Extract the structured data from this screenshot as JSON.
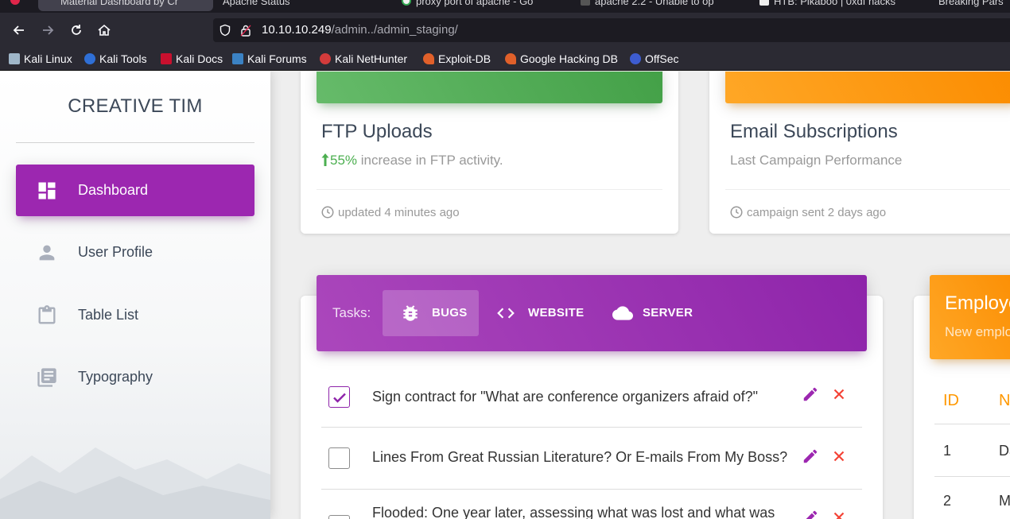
{
  "browser": {
    "tabs": [
      {
        "label": "Material Dashboard by Cr"
      },
      {
        "label": "Apache Status"
      },
      {
        "label": "proxy port of apache - Go"
      },
      {
        "label": "apache 2.2 - Unable to op"
      },
      {
        "label": "HTB: Pikaboo | 0xdf hacks"
      },
      {
        "label": "Breaking Pars"
      }
    ],
    "url_host": "10.10.10.249",
    "url_path": "/admin../admin_staging/",
    "bookmarks": [
      {
        "label": "Kali Linux",
        "color": "#9fb6c9"
      },
      {
        "label": "Kali Tools",
        "color": "#2f6fd6"
      },
      {
        "label": "Kali Docs",
        "color": "#c8102e"
      },
      {
        "label": "Kali Forums",
        "color": "#3b82c4"
      },
      {
        "label": "Kali NetHunter",
        "color": "#d23b3b"
      },
      {
        "label": "Exploit-DB",
        "color": "#e0602a"
      },
      {
        "label": "Google Hacking DB",
        "color": "#e0602a"
      },
      {
        "label": "OffSec",
        "color": "#3d5ccf"
      }
    ]
  },
  "sidebar": {
    "brand": "CREATIVE TIM",
    "items": [
      {
        "label": "Dashboard",
        "icon": "dashboard-icon",
        "active": true
      },
      {
        "label": "User Profile",
        "icon": "person-icon",
        "active": false
      },
      {
        "label": "Table List",
        "icon": "clipboard-icon",
        "active": false
      },
      {
        "label": "Typography",
        "icon": "library-books-icon",
        "active": false
      }
    ]
  },
  "cards": {
    "ftp": {
      "title": "FTP Uploads",
      "stat": "55%",
      "stat_text": " increase in FTP activity.",
      "footer": "updated 4 minutes ago"
    },
    "email": {
      "title": "Email Subscriptions",
      "category": "Last Campaign Performance",
      "footer": "campaign sent 2 days ago"
    }
  },
  "tasks": {
    "label": "Tasks:",
    "tabs": [
      {
        "label": "BUGS",
        "icon": "bug-icon",
        "active": true
      },
      {
        "label": "WEBSITE",
        "icon": "code-icon",
        "active": false
      },
      {
        "label": "SERVER",
        "icon": "cloud-icon",
        "active": false
      }
    ],
    "items": [
      {
        "text": "Sign contract for \"What are conference organizers afraid of?\"",
        "checked": true
      },
      {
        "text": "Lines From Great Russian Literature? Or E-mails From My Boss?",
        "checked": false
      },
      {
        "text": "Flooded: One year later, assessing what was lost and what was",
        "checked": false
      }
    ]
  },
  "employees": {
    "title": "Employees Stats",
    "subtitle": "New employees",
    "headers": [
      "ID",
      "Name"
    ],
    "rows": [
      {
        "id": "1",
        "name": "Dakota Rice"
      },
      {
        "id": "2",
        "name": "Minerva Hooper"
      }
    ]
  },
  "colors": {
    "primary": "#9c27b0",
    "success": "#4caf50",
    "warning": "#ff9800",
    "danger": "#f44336"
  }
}
